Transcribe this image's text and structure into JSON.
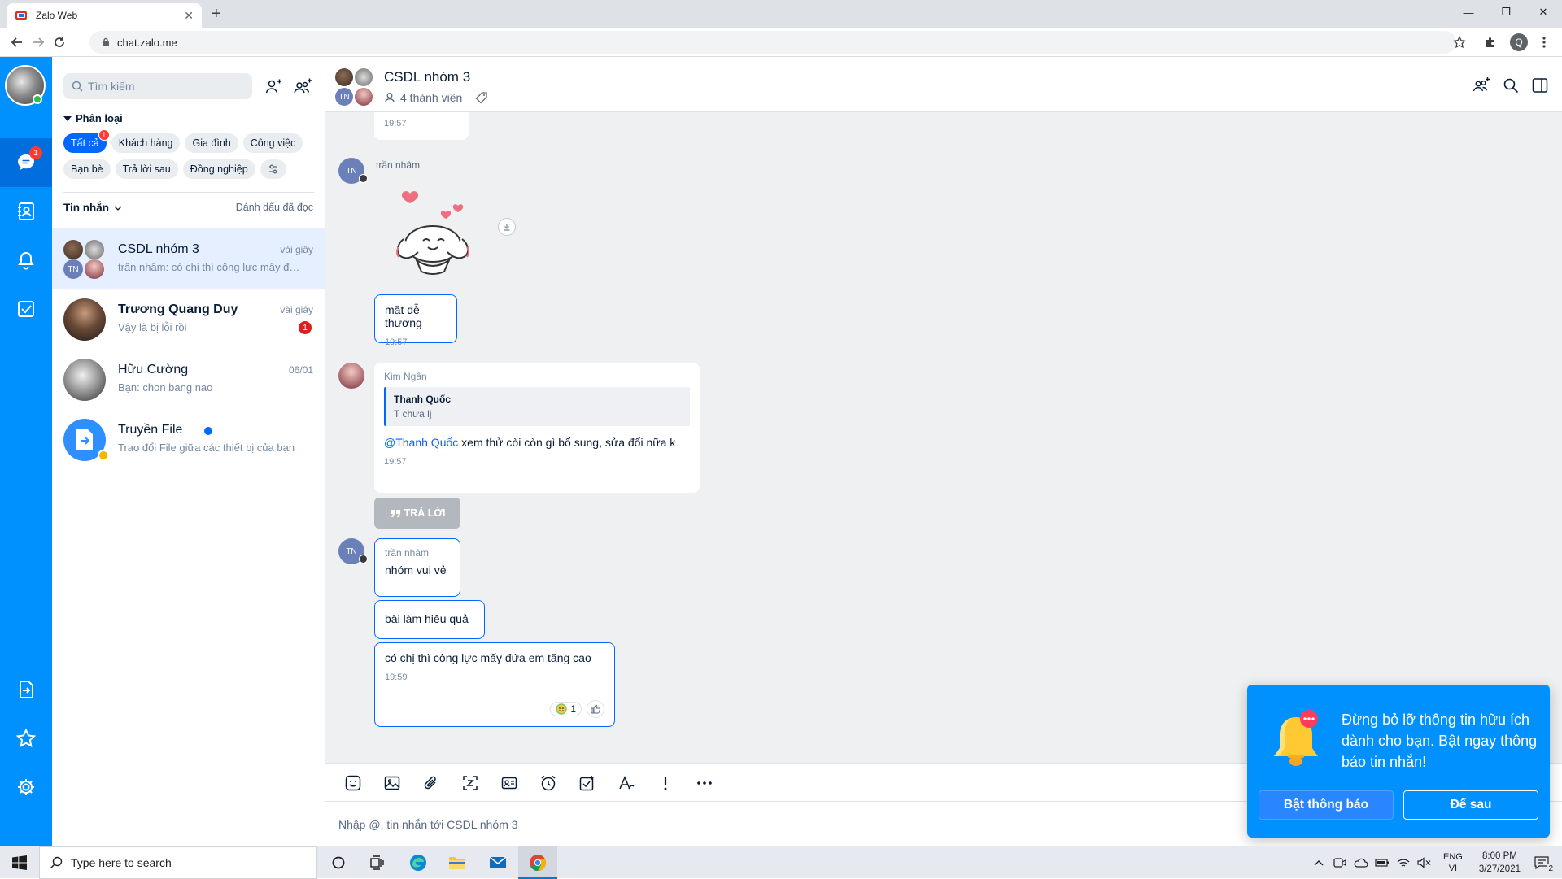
{
  "browser": {
    "tab_title": "Zalo Web",
    "url": "chat.zalo.me",
    "profile_initial": "Q"
  },
  "nav": {
    "messages_badge": "1"
  },
  "sidebar": {
    "search_placeholder": "Tìm kiếm",
    "category_title": "Phân loại",
    "chips_row1": [
      "Tất cả",
      "Khách hàng",
      "Gia đình",
      "Công việc"
    ],
    "chips_row2": [
      "Bạn bè",
      "Trả lời sau",
      "Đồng nghiệp"
    ],
    "all_badge": "1",
    "inbox_title": "Tin nhắn",
    "mark_read": "Đánh dấu đã đọc",
    "conversations": [
      {
        "name": "CSDL nhóm 3",
        "preview": "trần nhâm: có chị thì công lực mấy đứa em tăng cao",
        "time": "vài giây"
      },
      {
        "name": "Trương Quang Duy",
        "preview": "Vậy là bị lỗi rồi",
        "time": "vài giây",
        "unread": "1"
      },
      {
        "name": "Hữu Cường",
        "preview": "Bạn: chon bang nao",
        "time": "06/01"
      },
      {
        "name": "Truyền File",
        "preview": "Trao đổi File giữa các thiết bị của bạn",
        "time": ""
      }
    ]
  },
  "chat": {
    "title": "CSDL nhóm 3",
    "members": "4 thành viên",
    "tn_initials": "TN",
    "messages": [
      {
        "time": "19:57"
      },
      {
        "sender": "trần nhâm"
      },
      {
        "text": "mặt dễ thương",
        "time": "19:57"
      },
      {
        "sender": "Kim Ngân",
        "quote_name": "Thanh Quốc",
        "quote_text": "T chưa lj",
        "mention": "@Thanh Quốc",
        "text": " xem thử còi còn gì bổ sung, sửa đổi nữa k",
        "time": "19:57"
      },
      {
        "sender": "trần nhâm",
        "text": "nhóm vui vẻ"
      },
      {
        "text": "bài làm hiệu quả"
      },
      {
        "text": "có chị thì công lực mấy đứa em tăng cao",
        "time": "19:59",
        "reaction_count": "1"
      }
    ],
    "reply_label": "TRẢ LỜI",
    "composer_placeholder": "Nhập @, tin nhắn tới CSDL nhóm 3"
  },
  "notification": {
    "message": "Đừng bỏ lỡ thông tin hữu ích dành cho bạn. Bật ngay thông báo tin nhắn!",
    "enable_label": "Bật thông báo",
    "later_label": "Để sau"
  },
  "taskbar": {
    "search_placeholder": "Type here to search",
    "lang_top": "ENG",
    "lang_bottom": "VI",
    "time": "8:00 PM",
    "date": "3/27/2021",
    "notif_count": "2"
  },
  "colors": {
    "zalo_blue": "#0091ff",
    "accent": "#0068ff",
    "badge_red": "#ff3b30"
  }
}
